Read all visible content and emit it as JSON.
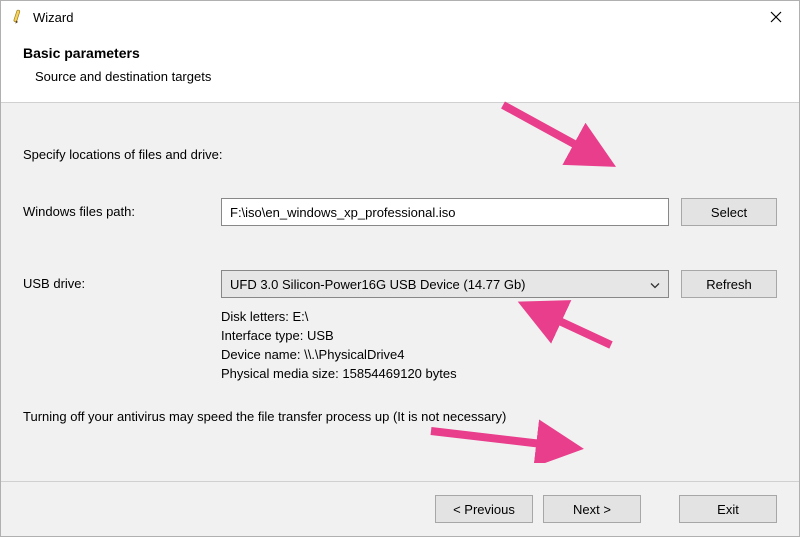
{
  "window": {
    "title": "Wizard"
  },
  "header": {
    "title": "Basic parameters",
    "subtitle": "Source and destination targets"
  },
  "body": {
    "instruction": "Specify locations of files and drive:",
    "files_path": {
      "label": "Windows files path:",
      "value": "F:\\iso\\en_windows_xp_professional.iso",
      "button": "Select"
    },
    "usb_drive": {
      "label": "USB drive:",
      "selected": "UFD 3.0 Silicon-Power16G USB Device (14.77 Gb)",
      "button": "Refresh",
      "details": {
        "disk_letters": "Disk letters: E:\\",
        "interface_type": "Interface type: USB",
        "device_name": "Device name: \\\\.\\PhysicalDrive4",
        "physical_size": "Physical media size: 15854469120 bytes"
      }
    },
    "antivirus_note": "Turning off your antivirus may speed the file transfer process up (It is not necessary)"
  },
  "footer": {
    "previous": "< Previous",
    "next": "Next >",
    "exit": "Exit"
  }
}
